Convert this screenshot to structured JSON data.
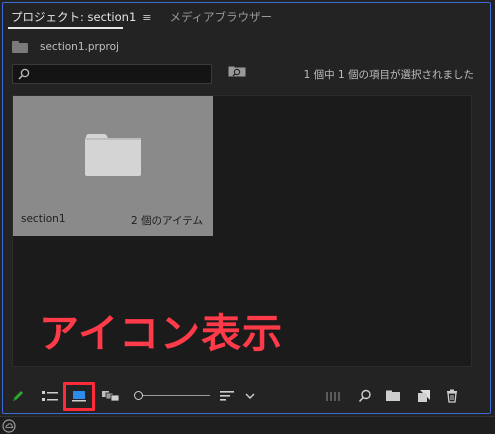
{
  "tabs": [
    {
      "label": "プロジェクト: section1",
      "active": true
    },
    {
      "label": "メディアブラウザー",
      "active": false
    }
  ],
  "tab_menu_glyph": "≡",
  "project": {
    "filename": "section1.prproj"
  },
  "search": {
    "value": "",
    "placeholder": ""
  },
  "selection_status": "1 個中 1 個の項目が選択されました",
  "bin_item": {
    "name": "section1",
    "count_label": "2 個のアイテム"
  },
  "annotation": {
    "text": "アイコン表示",
    "color": "#ff3b4a"
  },
  "toolbar": {
    "items": [
      "pencil-icon",
      "list-view-icon",
      "icon-view-icon",
      "freeform-view-icon",
      "zoom-slider",
      "sort-icon",
      "chevron-down-icon",
      "automate-sequence-icon",
      "find-icon",
      "new-bin-icon",
      "new-item-icon",
      "trash-icon"
    ],
    "zoom_level": 0.0
  },
  "colors": {
    "accent_frame": "#3c6ad6",
    "highlight": "#ff2a3a",
    "pencil": "#2eaa2e",
    "icon_view": "#2d8ceb"
  }
}
